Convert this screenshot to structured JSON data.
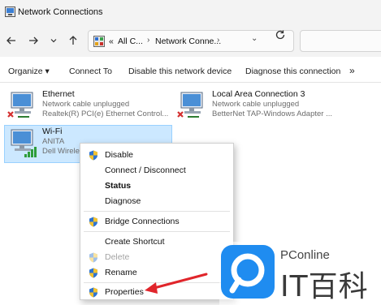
{
  "window": {
    "title": "Network Connections"
  },
  "address": {
    "overflow": "«",
    "crumb1": "All C...",
    "crumb2": "Network Conne...",
    "chevron": "›",
    "dropdown": "⌄"
  },
  "commands": {
    "organize": "Organize ▾",
    "connect_to": "Connect To",
    "disable": "Disable this network device",
    "diagnose": "Diagnose this connection",
    "more": "»"
  },
  "connections": [
    {
      "name": "Ethernet",
      "status": "Network cable unplugged",
      "adapter": "Realtek(R) PCI(e) Ethernet Control...",
      "error": true
    },
    {
      "name": "Local Area Connection 3",
      "status": "Network cable unplugged",
      "adapter": "BetterNet TAP-Windows Adapter ...",
      "error": true
    },
    {
      "name": "Wi-Fi",
      "status": "ANITA",
      "adapter": "Dell Wirele",
      "selected": true
    }
  ],
  "context_menu": {
    "items": [
      {
        "label": "Disable",
        "shield": true
      },
      {
        "label": "Connect / Disconnect"
      },
      {
        "label": "Status",
        "bold": true
      },
      {
        "label": "Diagnose"
      },
      {
        "label": "Bridge Connections",
        "shield": true
      },
      {
        "label": "Create Shortcut"
      },
      {
        "label": "Delete",
        "shield": true,
        "disabled": true
      },
      {
        "label": "Rename",
        "shield": true
      },
      {
        "label": "Properties",
        "shield": true
      }
    ]
  },
  "watermark": {
    "brand_small": "PConline",
    "brand_large": "IT百科"
  },
  "colors": {
    "selection": "#cce8ff",
    "arrow": "#e0252b",
    "watermark_blue": "#1f8cf0"
  }
}
